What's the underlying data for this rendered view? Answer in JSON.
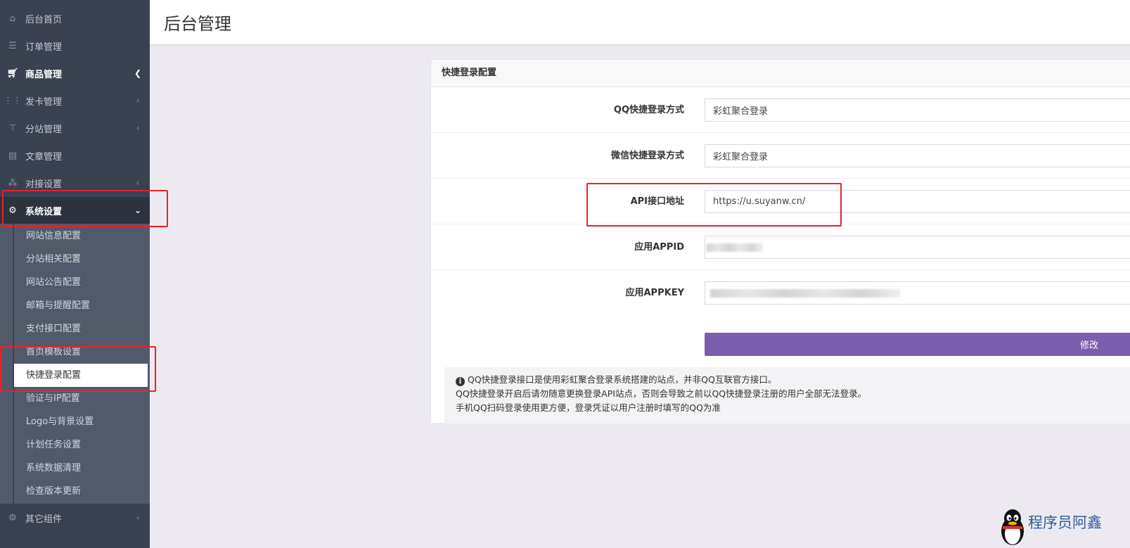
{
  "page": {
    "title": "后台管理"
  },
  "sidebar": {
    "items": [
      {
        "label": "后台首页",
        "icon": "home-icon"
      },
      {
        "label": "订单管理",
        "icon": "list-icon"
      },
      {
        "label": "商品管理",
        "icon": "cart-icon"
      },
      {
        "label": "发卡管理",
        "icon": "grid-icon"
      },
      {
        "label": "分站管理",
        "icon": "sitemap-icon"
      },
      {
        "label": "文章管理",
        "icon": "book-icon"
      },
      {
        "label": "对接设置",
        "icon": "cubes-icon"
      },
      {
        "label": "系统设置",
        "icon": "gear-icon"
      },
      {
        "label": "其它组件",
        "icon": "gears-icon"
      }
    ],
    "submenu": [
      "网站信息配置",
      "分站相关配置",
      "网站公告配置",
      "邮箱与提醒配置",
      "支付接口配置",
      "首页模板设置",
      "快捷登录配置",
      "验证与IP配置",
      "Logo与背景设置",
      "计划任务设置",
      "系统数据清理",
      "检查版本更新"
    ]
  },
  "panel": {
    "heading": "快捷登录配置",
    "fields": [
      {
        "label": "QQ快捷登录方式",
        "value": "彩虹聚合登录"
      },
      {
        "label": "微信快捷登录方式",
        "value": "彩虹聚合登录"
      },
      {
        "label": "API接口地址",
        "value": "https://u.suyanw.cn/"
      },
      {
        "label": "应用APPID",
        "value": ""
      },
      {
        "label": "应用APPKEY",
        "value": ""
      }
    ],
    "submit_label": "修改",
    "notice": [
      "QQ快捷登录接口是使用彩虹聚合登录系统搭建的站点，并非QQ互联官方接口。",
      "QQ快捷登录开启后请勿随意更换登录API站点，否则会导致之前以QQ快捷登录注册的用户全部无法登录。",
      "手机QQ扫码登录使用更方便，登录凭证以用户注册时填写的QQ为准"
    ]
  },
  "watermark": {
    "text": "程序员阿鑫"
  },
  "colors": {
    "sidebar_bg": "#3a4150",
    "submenu_bg": "#515a6b",
    "accent_button": "#7b5fae",
    "annotation_red": "#e8222a"
  }
}
